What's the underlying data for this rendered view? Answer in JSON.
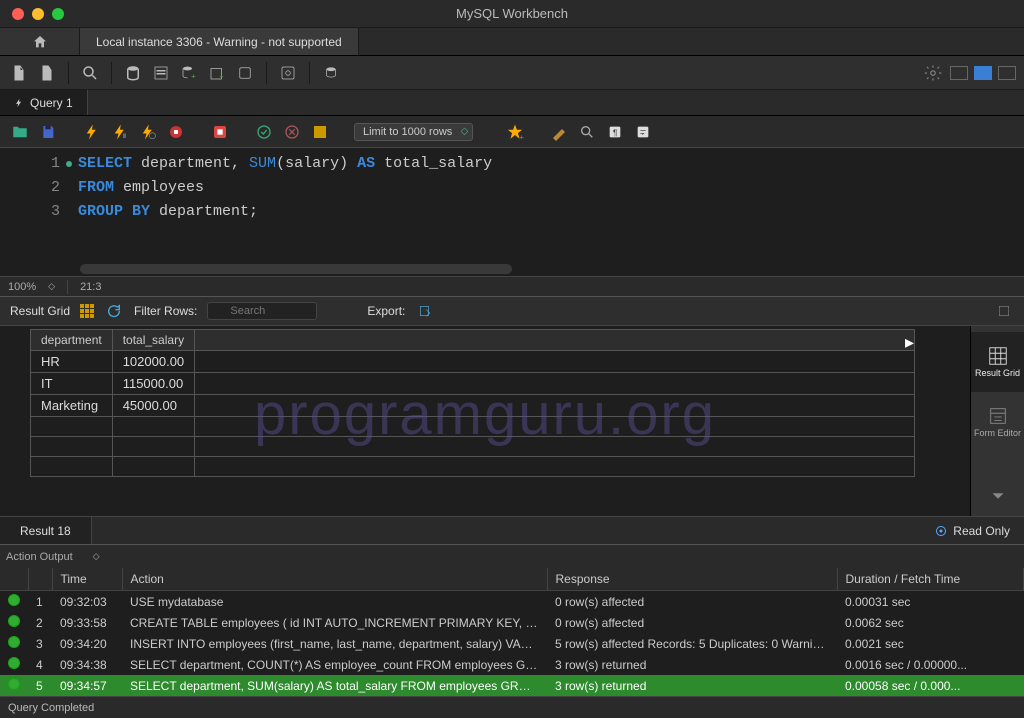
{
  "title": "MySQL Workbench",
  "connection_tab": "Local instance 3306 - Warning - not supported",
  "query_tab": "Query 1",
  "limit_label": "Limit to 1000 rows",
  "editor": {
    "lines": [
      {
        "num": "1",
        "has_dot": true,
        "code_html": "<span class='kw'>SELECT</span> department, <span class='fn'>SUM</span>(salary) <span class='kw'>AS</span> total_salary"
      },
      {
        "num": "2",
        "has_dot": false,
        "code_html": "<span class='kw'>FROM</span> employees"
      },
      {
        "num": "3",
        "has_dot": false,
        "code_html": "<span class='kw'>GROUP BY</span> department;"
      }
    ]
  },
  "zoom": "100%",
  "cursor_pos": "21:3",
  "result_toolbar": {
    "label": "Result Grid",
    "filter_label": "Filter Rows:",
    "filter_placeholder": "Search",
    "export_label": "Export:"
  },
  "grid_columns": [
    "department",
    "total_salary"
  ],
  "grid_rows": [
    [
      "HR",
      "102000.00"
    ],
    [
      "IT",
      "115000.00"
    ],
    [
      "Marketing",
      "45000.00"
    ]
  ],
  "watermark": "programguru.org",
  "side_buttons": [
    {
      "label": "Result Grid"
    },
    {
      "label": "Form Editor"
    }
  ],
  "result_tab": "Result 18",
  "readonly_label": "Read Only",
  "output_dropdown": "Action Output",
  "output_columns": [
    "",
    "",
    "Time",
    "Action",
    "Response",
    "Duration / Fetch Time"
  ],
  "output_rows": [
    {
      "idx": "1",
      "time": "09:32:03",
      "action": "USE mydatabase",
      "response": "0 row(s) affected",
      "duration": "0.00031 sec",
      "sel": false
    },
    {
      "idx": "2",
      "time": "09:33:58",
      "action": "CREATE TABLE employees (     id INT AUTO_INCREMENT PRIMARY KEY,     firs...",
      "response": "0 row(s) affected",
      "duration": "0.0062 sec",
      "sel": false
    },
    {
      "idx": "3",
      "time": "09:34:20",
      "action": "INSERT INTO employees (first_name, last_name, department, salary) VALUES...",
      "response": "5 row(s) affected Records: 5  Duplicates: 0  Warnings...",
      "duration": "0.0021 sec",
      "sel": false
    },
    {
      "idx": "4",
      "time": "09:34:38",
      "action": "SELECT department, COUNT(*) AS employee_count FROM employees GROUP...",
      "response": "3 row(s) returned",
      "duration": "0.0016 sec / 0.00000...",
      "sel": false
    },
    {
      "idx": "5",
      "time": "09:34:57",
      "action": "SELECT department, SUM(salary) AS total_salary FROM employees GROUP B...",
      "response": "3 row(s) returned",
      "duration": "0.00058 sec / 0.000...",
      "sel": true
    }
  ],
  "status_text": "Query Completed"
}
